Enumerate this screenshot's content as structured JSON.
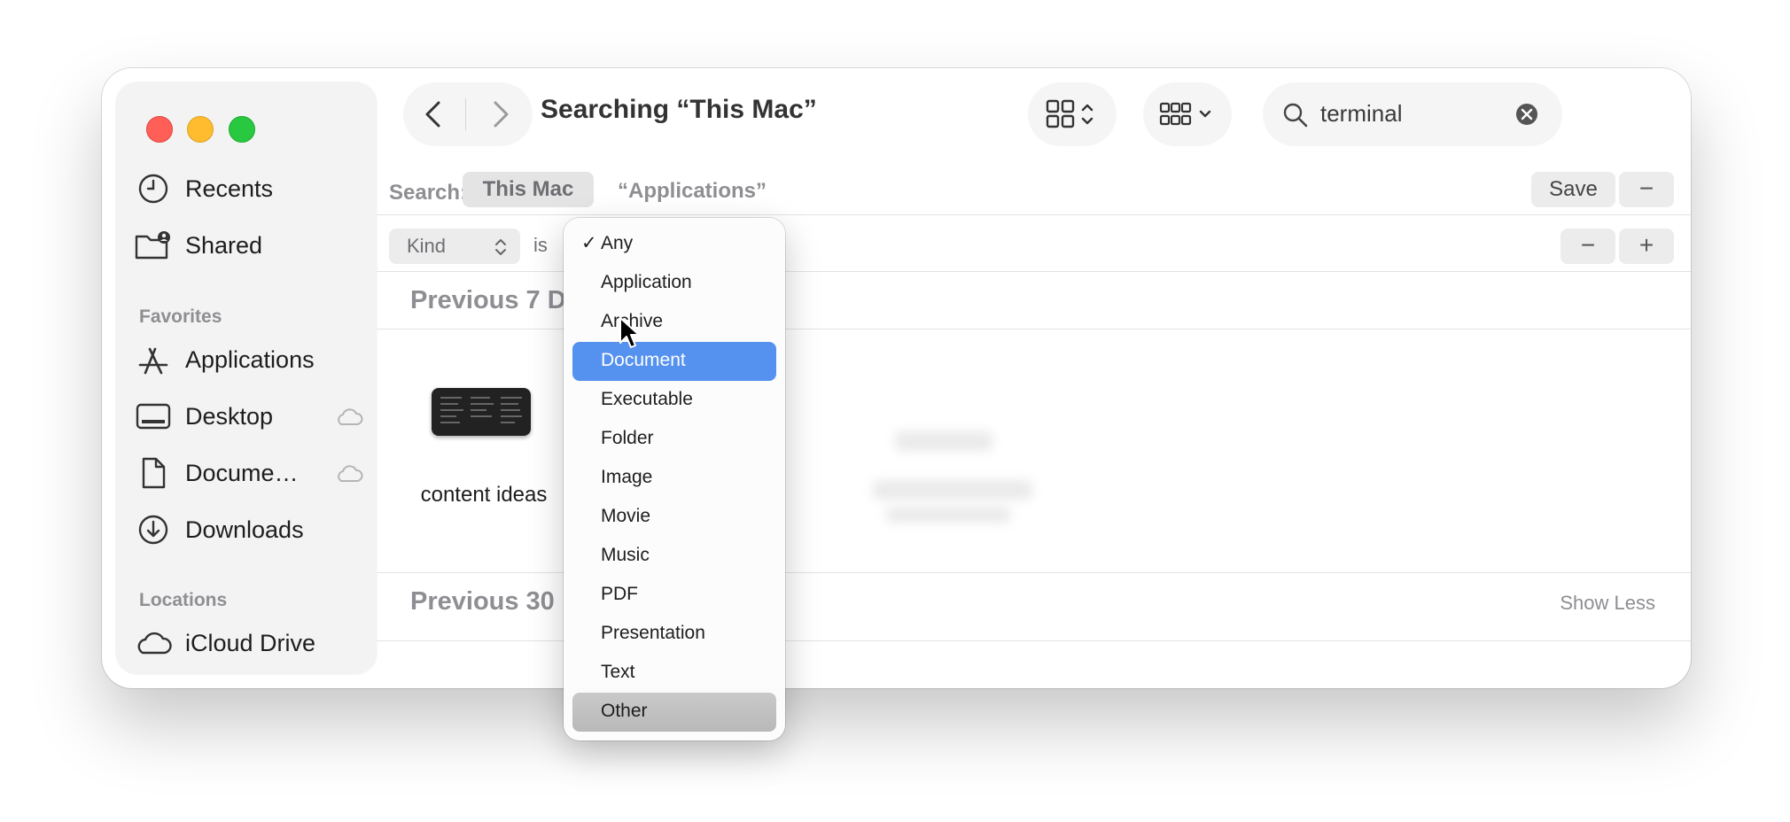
{
  "window": {
    "title": "Searching “This Mac”"
  },
  "sidebar": {
    "items_top": [
      {
        "label": "Recents",
        "icon": "clock-icon"
      },
      {
        "label": "Shared",
        "icon": "shared-folder-icon"
      }
    ],
    "favorites_heading": "Favorites",
    "favorites": [
      {
        "label": "Applications",
        "icon": "applications-icon"
      },
      {
        "label": "Desktop",
        "icon": "desktop-icon"
      },
      {
        "label": "Docume…",
        "icon": "document-icon"
      },
      {
        "label": "Downloads",
        "icon": "downloads-icon"
      }
    ],
    "locations_heading": "Locations",
    "locations": [
      {
        "label": "iCloud Drive",
        "icon": "icloud-icon"
      }
    ]
  },
  "search": {
    "query": "terminal"
  },
  "scope": {
    "label": "Search:",
    "this_mac": "This Mac",
    "applications": "“Applications”",
    "save": "Save",
    "minus": "−"
  },
  "criteria": {
    "attribute": "Kind",
    "operator": "is",
    "minus": "−",
    "plus": "+"
  },
  "results": {
    "section1": "Previous 7 D",
    "section2": "Previous 30",
    "show_less": "Show Less",
    "file_name": "content ideas"
  },
  "kind_menu": {
    "check": "✓",
    "items": [
      "Any",
      "Application",
      "Archive",
      "Document",
      "Executable",
      "Folder",
      "Image",
      "Movie",
      "Music",
      "PDF",
      "Presentation",
      "Text",
      "Other"
    ],
    "checked": "Any",
    "highlighted": "Document"
  },
  "colors": {
    "accent": "#5591ef",
    "close": "#ff5f57",
    "minimize": "#febc2e",
    "zoom": "#28c840"
  }
}
